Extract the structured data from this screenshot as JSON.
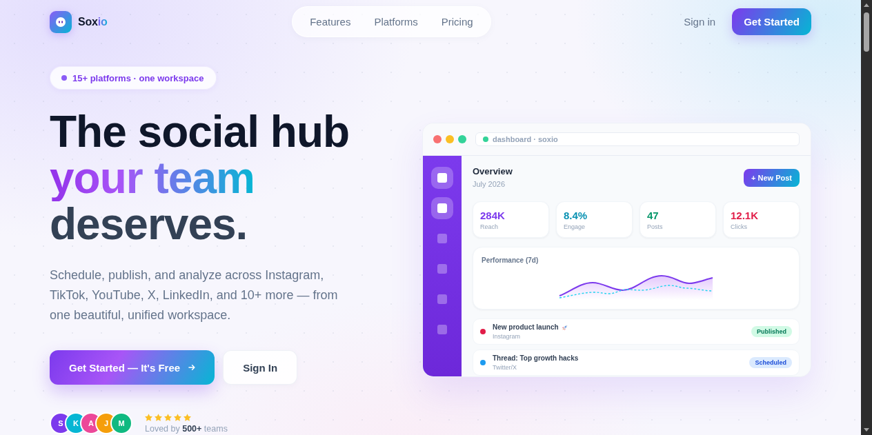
{
  "nav": {
    "brand": {
      "name": "Sox",
      "name_accent": "io"
    },
    "links": [
      {
        "label": "Features"
      },
      {
        "label": "Platforms"
      },
      {
        "label": "Pricing"
      }
    ],
    "sign_in": "Sign in",
    "cta": "Get Started"
  },
  "hero": {
    "badge": "15+ platforms · one workspace",
    "headline": [
      {
        "text": "The social hub",
        "kind": "dark"
      },
      {
        "text": "your team",
        "kind": "gradient"
      },
      {
        "text": "deserves.",
        "kind": "slate"
      }
    ],
    "description": "Schedule, publish, and analyze across Instagram, TikTok, YouTube, X, LinkedIn, and 10+ more — from one beautiful, unified workspace.",
    "buttons": [
      {
        "label": "Get Started — It's Free",
        "kind": "primary"
      },
      {
        "label": "Sign In",
        "kind": "secondary"
      }
    ],
    "social_proof": {
      "avatars": [
        {
          "initial": "S",
          "color": "#7c3aed"
        },
        {
          "initial": "K",
          "color": "#06b6d4"
        },
        {
          "initial": "A",
          "color": "#ec4899"
        },
        {
          "initial": "J",
          "color": "#f59e0b"
        },
        {
          "initial": "M",
          "color": "#10b981"
        }
      ],
      "stars": 5,
      "caption": "Loved by **500+** teams"
    }
  },
  "dashboard": {
    "address": "dashboard · soxio",
    "sidebar": {
      "items": [
        {
          "selected": true
        },
        {
          "selected": true
        },
        {
          "selected": false
        },
        {
          "selected": false
        },
        {
          "selected": false
        },
        {
          "selected": false
        }
      ]
    },
    "title": "Overview",
    "subtitle": "July 2026",
    "new_post_button": "+ New Post",
    "stats": [
      {
        "value": "284K",
        "label": "Reach",
        "color": "#7c3aed"
      },
      {
        "value": "8.4%",
        "label": "Engage",
        "color": "#0891b2"
      },
      {
        "value": "47",
        "label": "Posts",
        "color": "#059669"
      },
      {
        "value": "12.1K",
        "label": "Clicks",
        "color": "#e11d48"
      }
    ],
    "performance": {
      "title": "Performance (7d)"
    },
    "posts": [
      {
        "title": "New product launch",
        "trailing_icon": true,
        "platform": "Instagram",
        "status": "Published",
        "kind": "published",
        "color": "#e11d48"
      },
      {
        "title": "Thread: Top growth hacks",
        "trailing_icon": false,
        "platform": "Twitter/X",
        "status": "Scheduled",
        "kind": "scheduled",
        "color": "#1d9bf0"
      }
    ]
  }
}
